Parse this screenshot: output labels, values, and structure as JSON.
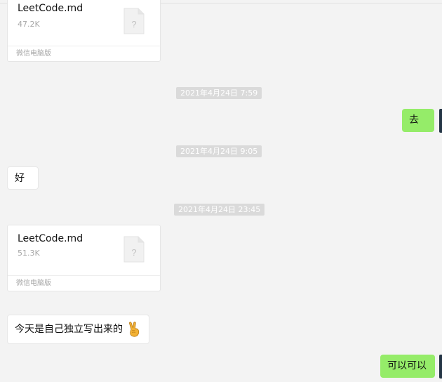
{
  "messages": {
    "file1": {
      "name": "LeetCode.md",
      "size": "47.2K",
      "source": "微信电脑版"
    },
    "ts1": "2021年4月24日 7:59",
    "msg_out_1": "去",
    "ts2": "2021年4月24日 9:05",
    "msg_in_1": "好",
    "ts3": "2021年4月24日 23:45",
    "file2": {
      "name": "LeetCode.md",
      "size": "51.3K",
      "source": "微信电脑版"
    },
    "msg_in_2": "今天是自己独立写出来的",
    "msg_in_2_emoji": "victory-hand-emoji",
    "msg_out_2": "可以可以"
  },
  "colors": {
    "background": "#f3f3f3",
    "outgoing_bubble": "#95ec69",
    "incoming_bubble": "#ffffff",
    "timestamp_bg": "#dadada"
  }
}
